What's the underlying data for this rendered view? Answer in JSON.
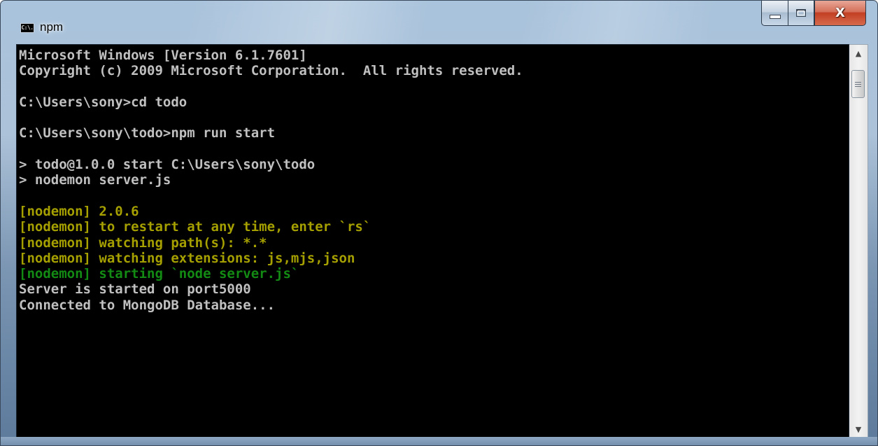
{
  "window": {
    "title": "npm",
    "icon_text": "C:\\.",
    "controls": {
      "minimize_icon": "minimize-icon",
      "maximize_icon": "maximize-icon",
      "close_icon": "close-icon",
      "close_glyph": "X"
    }
  },
  "console": {
    "lines": [
      {
        "text": "Microsoft Windows [Version 6.1.7601]",
        "color": "#c0c0c0"
      },
      {
        "text": "Copyright (c) 2009 Microsoft Corporation.  All rights reserved.",
        "color": "#c0c0c0"
      },
      {
        "text": "",
        "color": "#c0c0c0"
      },
      {
        "text": "C:\\Users\\sony>cd todo",
        "color": "#c0c0c0"
      },
      {
        "text": "",
        "color": "#c0c0c0"
      },
      {
        "text": "C:\\Users\\sony\\todo>npm run start",
        "color": "#c0c0c0"
      },
      {
        "text": "",
        "color": "#c0c0c0"
      },
      {
        "text": "> todo@1.0.0 start C:\\Users\\sony\\todo",
        "color": "#c0c0c0"
      },
      {
        "text": "> nodemon server.js",
        "color": "#c0c0c0"
      },
      {
        "text": "",
        "color": "#c0c0c0"
      },
      {
        "text": "[nodemon] 2.0.6",
        "color": "#a5a000"
      },
      {
        "text": "[nodemon] to restart at any time, enter `rs`",
        "color": "#a5a000"
      },
      {
        "text": "[nodemon] watching path(s): *.*",
        "color": "#a5a000"
      },
      {
        "text": "[nodemon] watching extensions: js,mjs,json",
        "color": "#a5a000"
      },
      {
        "text": "[nodemon] starting `node server.js`",
        "color": "#138a13"
      },
      {
        "text": "Server is started on port5000",
        "color": "#c0c0c0"
      },
      {
        "text": "Connected to MongoDB Database...",
        "color": "#c0c0c0"
      }
    ]
  },
  "scrollbar": {
    "up_arrow": "▲",
    "down_arrow": "▼",
    "up_icon": "scroll-up-arrow-icon",
    "down_icon": "scroll-down-arrow-icon"
  },
  "colors": {
    "console_background": "#000000",
    "default_text": "#c0c0c0",
    "nodemon_yellow": "#a5a000",
    "nodemon_green": "#138a13",
    "close_button": "#c23f23"
  }
}
